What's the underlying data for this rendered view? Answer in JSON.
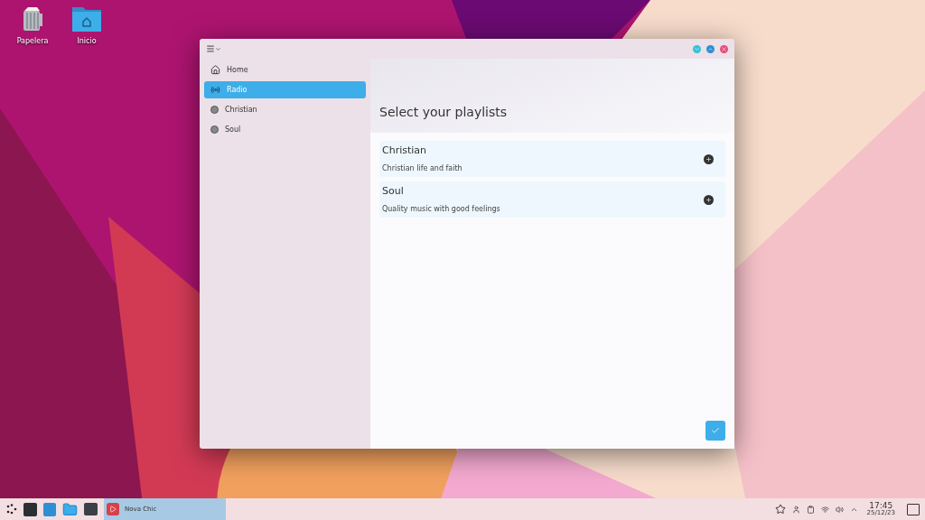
{
  "desktop": {
    "icons": [
      {
        "label": "Papelera",
        "kind": "trash"
      },
      {
        "label": "Inicio",
        "kind": "folder"
      }
    ]
  },
  "window": {
    "sidebar": {
      "items": [
        {
          "label": "Home",
          "kind": "home",
          "selected": false
        },
        {
          "label": "Radio",
          "kind": "radio",
          "selected": true
        },
        {
          "label": "Christian",
          "kind": "dot",
          "selected": false
        },
        {
          "label": "Soul",
          "kind": "dot",
          "selected": false
        }
      ]
    },
    "heading": "Select your playlists",
    "playlists": [
      {
        "title": "Christian",
        "description": "Christian life and faith"
      },
      {
        "title": "Soul",
        "description": "Quality music with good feelings"
      }
    ]
  },
  "taskbar": {
    "tasks": [
      {
        "label": "Nova Chic",
        "selected": true
      }
    ],
    "clock": {
      "time": "17:45",
      "date": "25/12/23"
    }
  }
}
